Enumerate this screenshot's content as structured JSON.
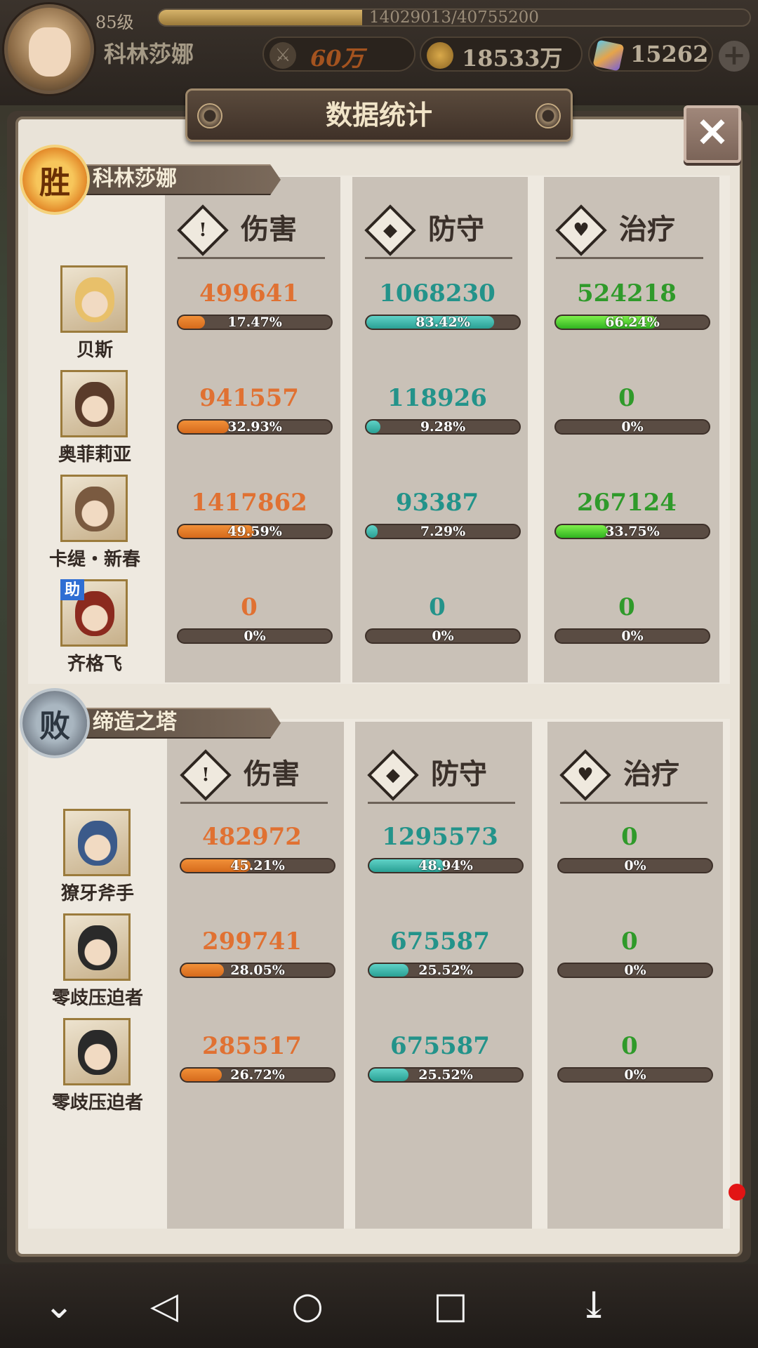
{
  "player": {
    "level": "85级",
    "exp": "14029013/40755200",
    "exp_ratio": 0.344,
    "name": "科林莎娜"
  },
  "currency": {
    "power": "60万",
    "gold": "18533万",
    "gems": "15262"
  },
  "dialog": {
    "title": "数据统计"
  },
  "stats_headers": {
    "damage": "伤害",
    "defense": "防守",
    "healing": "治疗"
  },
  "winner": {
    "result": "胜",
    "team_name": "科林莎娜",
    "heroes": [
      {
        "name": "贝斯",
        "assist": "",
        "damage": "499641",
        "damage_pct": "17.47%",
        "damage_ratio": 0.1747,
        "defense": "1068230",
        "defense_pct": "83.42%",
        "defense_ratio": 0.8342,
        "healing": "524218",
        "healing_pct": "66.24%",
        "healing_ratio": 0.6624
      },
      {
        "name": "奥菲莉亚",
        "assist": "",
        "damage": "941557",
        "damage_pct": "32.93%",
        "damage_ratio": 0.3293,
        "defense": "118926",
        "defense_pct": "9.28%",
        "defense_ratio": 0.0928,
        "healing": "0",
        "healing_pct": "0%",
        "healing_ratio": 0
      },
      {
        "name": "卡缇・新春",
        "assist": "",
        "damage": "1417862",
        "damage_pct": "49.59%",
        "damage_ratio": 0.4959,
        "defense": "93387",
        "defense_pct": "7.29%",
        "defense_ratio": 0.0729,
        "healing": "267124",
        "healing_pct": "33.75%",
        "healing_ratio": 0.3375
      },
      {
        "name": "齐格飞",
        "assist": "助",
        "damage": "0",
        "damage_pct": "0%",
        "damage_ratio": 0,
        "defense": "0",
        "defense_pct": "0%",
        "defense_ratio": 0,
        "healing": "0",
        "healing_pct": "0%",
        "healing_ratio": 0
      }
    ]
  },
  "loser": {
    "result": "败",
    "team_name": "缔造之塔",
    "heroes": [
      {
        "name": "獠牙斧手",
        "damage": "482972",
        "damage_pct": "45.21%",
        "damage_ratio": 0.4521,
        "defense": "1295573",
        "defense_pct": "48.94%",
        "defense_ratio": 0.4894,
        "healing": "0",
        "healing_pct": "0%",
        "healing_ratio": 0
      },
      {
        "name": "零歧压迫者",
        "damage": "299741",
        "damage_pct": "28.05%",
        "damage_ratio": 0.2805,
        "defense": "675587",
        "defense_pct": "25.52%",
        "defense_ratio": 0.2552,
        "healing": "0",
        "healing_pct": "0%",
        "healing_ratio": 0
      },
      {
        "name": "零歧压迫者",
        "damage": "285517",
        "damage_pct": "26.72%",
        "damage_ratio": 0.2672,
        "defense": "675587",
        "defense_pct": "25.52%",
        "defense_ratio": 0.2552,
        "healing": "0",
        "healing_pct": "0%",
        "healing_ratio": 0
      }
    ]
  },
  "colors": {
    "damage": "#e07132",
    "defense": "#23938a",
    "healing": "#2f9a2a"
  },
  "nav_icons": [
    "chevron-down-icon",
    "back-triangle-icon",
    "home-circle-icon",
    "recent-square-icon",
    "notification-pull-icon"
  ]
}
